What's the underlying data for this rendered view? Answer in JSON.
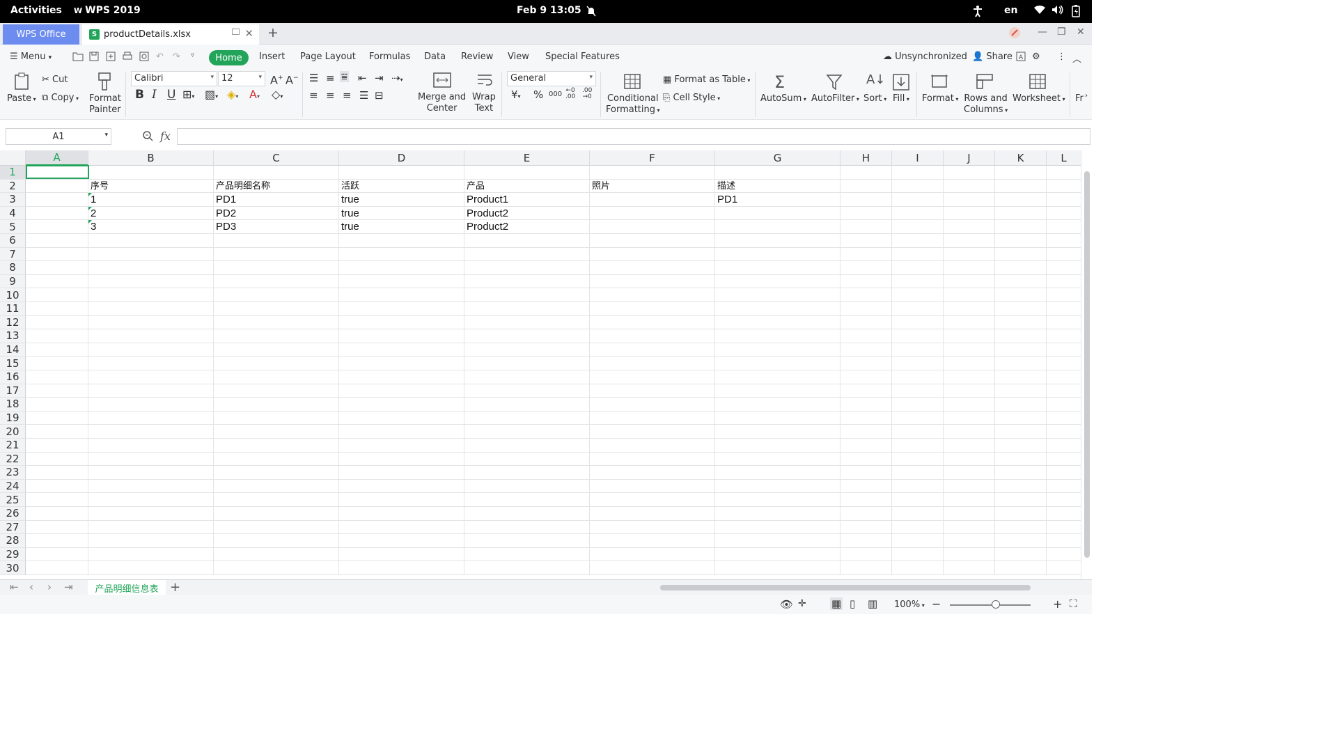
{
  "system_bar": {
    "activities": "Activities",
    "app_name": "WPS 2019",
    "clock": "Feb 9  13:05",
    "lang": "en"
  },
  "tabs": {
    "wps_tab": "WPS Office",
    "doc_tab": "productDetails.xlsx",
    "new_tab": "+"
  },
  "menu": {
    "menu_label": "Menu",
    "items": [
      "Home",
      "Insert",
      "Page Layout",
      "Formulas",
      "Data",
      "Review",
      "View",
      "Special Features"
    ],
    "sync_label": "Unsynchronized",
    "share_label": "Share"
  },
  "ribbon": {
    "paste": "Paste",
    "cut": "Cut",
    "copy": "Copy",
    "format_painter": "Format\nPainter",
    "font_name": "Calibri",
    "font_size": "12",
    "merge_center": "Merge and\nCenter",
    "wrap_text": "Wrap\nText",
    "number_format": "General",
    "conditional_formatting": "Conditional\nFormatting",
    "format_as_table": "Format as Table",
    "cell_style": "Cell Style",
    "autosum": "AutoSum",
    "autofilter": "AutoFilter",
    "sort": "Sort",
    "fill": "Fill",
    "format": "Format",
    "rows_columns": "Rows and\nColumns",
    "worksheet": "Worksheet",
    "more": "Fr"
  },
  "formula_bar": {
    "name_box": "A1",
    "fx_label": "fx",
    "formula": ""
  },
  "sheet": {
    "columns": [
      "A",
      "B",
      "C",
      "D",
      "E",
      "F",
      "G",
      "H",
      "I",
      "J",
      "K",
      "L"
    ],
    "rows": [
      "1",
      "2",
      "3",
      "4",
      "5",
      "6",
      "7",
      "8",
      "9",
      "10",
      "11",
      "12",
      "13",
      "14",
      "15",
      "16",
      "17",
      "18",
      "19",
      "20",
      "21",
      "22",
      "23",
      "24",
      "25",
      "26",
      "27",
      "28",
      "29",
      "30"
    ],
    "cells": {
      "B2": "序号",
      "C2": "产品明细名称",
      "D2": "活跃",
      "E2": "产品",
      "F2": "照片",
      "G2": "描述",
      "B3": "1",
      "C3": "PD1",
      "D3": "true",
      "E3": "Product1",
      "G3": "PD1",
      "B4": "2",
      "C4": "PD2",
      "D4": "true",
      "E4": "Product2",
      "B5": "3",
      "C5": "PD3",
      "D5": "true",
      "E5": "Product2"
    },
    "selected_cell": "A1",
    "sheet_tab": "产品明细信息表"
  },
  "status": {
    "zoom": "100%"
  },
  "colors": {
    "accent": "#22a55a",
    "wps_blue": "#6d8cf0"
  }
}
